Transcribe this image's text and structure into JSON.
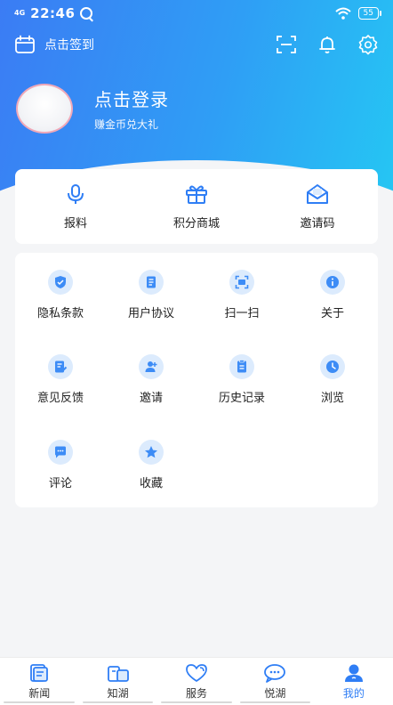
{
  "statusbar": {
    "network": "4G",
    "time": "22:46",
    "battery": "55"
  },
  "topbar": {
    "checkin_label": "点击签到"
  },
  "profile": {
    "title": "点击登录",
    "subtitle": "赚金币兑大礼"
  },
  "quick_actions": [
    {
      "label": "报料",
      "icon": "microphone-icon"
    },
    {
      "label": "积分商城",
      "icon": "gift-icon"
    },
    {
      "label": "邀请码",
      "icon": "envelope-icon"
    }
  ],
  "grid_items": [
    {
      "label": "隐私条款",
      "icon": "shield-icon"
    },
    {
      "label": "用户协议",
      "icon": "document-icon"
    },
    {
      "label": "扫一扫",
      "icon": "scan-icon"
    },
    {
      "label": "关于",
      "icon": "info-icon"
    },
    {
      "label": "意见反馈",
      "icon": "feedback-icon"
    },
    {
      "label": "邀请",
      "icon": "add-user-icon"
    },
    {
      "label": "历史记录",
      "icon": "history-icon"
    },
    {
      "label": "浏览",
      "icon": "clock-icon"
    },
    {
      "label": "评论",
      "icon": "comment-icon"
    },
    {
      "label": "收藏",
      "icon": "star-icon"
    }
  ],
  "tabs": [
    {
      "label": "新闻",
      "icon": "news-icon"
    },
    {
      "label": "知湖",
      "icon": "book-icon"
    },
    {
      "label": "服务",
      "icon": "heart-icon"
    },
    {
      "label": "悦湖",
      "icon": "chat-icon"
    },
    {
      "label": "我的",
      "icon": "user-icon",
      "active": true
    }
  ],
  "colors": {
    "accent": "#2f7ef5",
    "gradient_start": "#3b7cf4",
    "gradient_end": "#25c6f3",
    "icon_bg": "#dcebfd"
  }
}
